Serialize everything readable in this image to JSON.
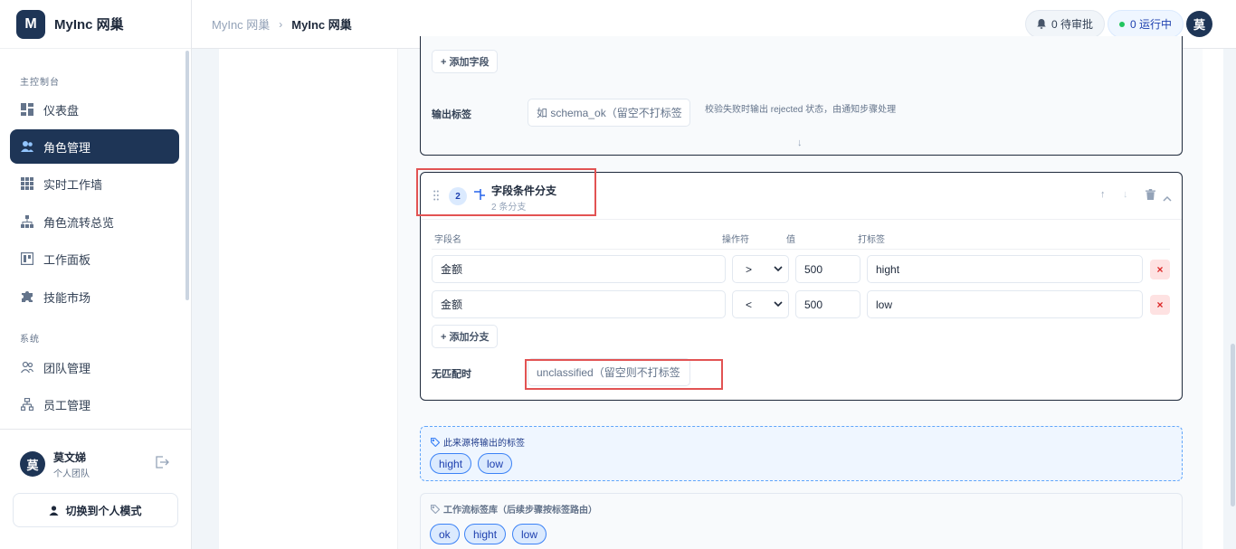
{
  "brand": {
    "logo_letter": "M",
    "name": "MyInc 网巢"
  },
  "sidebar": {
    "section_main": "主控制台",
    "section_system": "系统",
    "items": [
      {
        "label": "仪表盘",
        "icon": "dashboard-icon"
      },
      {
        "label": "角色管理",
        "icon": "users-icon",
        "active": true
      },
      {
        "label": "实时工作墙",
        "icon": "grid-icon"
      },
      {
        "label": "角色流转总览",
        "icon": "hierarchy-icon"
      },
      {
        "label": "工作面板",
        "icon": "panel-icon"
      },
      {
        "label": "技能市场",
        "icon": "puzzle-icon"
      }
    ],
    "system_items": [
      {
        "label": "团队管理",
        "icon": "team-icon"
      },
      {
        "label": "员工管理",
        "icon": "org-icon"
      }
    ],
    "user": {
      "avatar": "莫",
      "name": "莫文娣",
      "team": "个人团队"
    },
    "switch_label": "切换到个人模式"
  },
  "header": {
    "breadcrumb_root": "MyInc 网巢",
    "breadcrumb_current": "MyInc 网巢",
    "pending": "0 待审批",
    "running": "0 运行中",
    "avatar": "莫"
  },
  "step1": {
    "add_field": "+ 添加字段",
    "output_label": "输出标签",
    "output_placeholder": "如 schema_ok（留空不打标签",
    "hint": "校验失败时输出 rejected 状态，由通知步骤处理",
    "arrow": "↓"
  },
  "step2": {
    "number": "2",
    "title": "字段条件分支",
    "subtitle": "2 条分支",
    "col_field": "字段名",
    "col_op": "操作符",
    "col_value": "值",
    "col_tag": "打标签",
    "rows": [
      {
        "field": "金额",
        "op": ">",
        "value": "500",
        "tag": "hight"
      },
      {
        "field": "金额",
        "op": "<",
        "value": "500",
        "tag": "low"
      }
    ],
    "add_branch": "+ 添加分支",
    "no_match_label": "无匹配时",
    "no_match_value": "unclassified（留空则不打标签"
  },
  "tags_output": {
    "title": "此来源将输出的标签",
    "chips": [
      "hight",
      "low"
    ]
  },
  "tags_library": {
    "title": "工作流标签库（后续步骤按标签路由）",
    "chips": [
      "ok",
      "hight",
      "low"
    ]
  },
  "colors": {
    "accent": "#1e3556",
    "highlight": "#e25353",
    "chip": "#3b82f6"
  }
}
